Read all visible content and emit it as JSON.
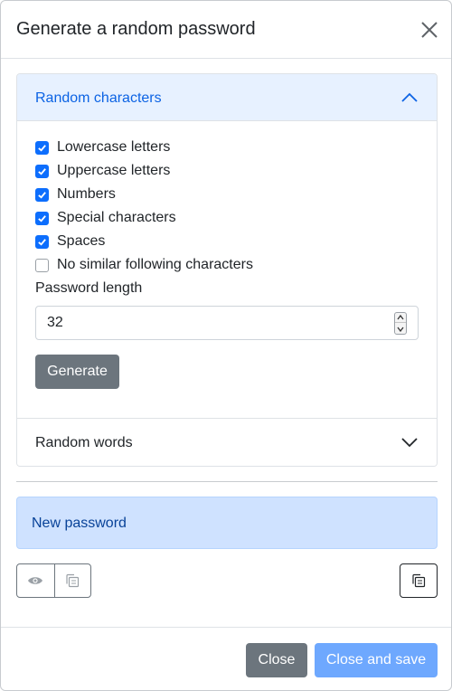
{
  "header": {
    "title": "Generate a random password",
    "close_icon": "close-icon"
  },
  "accordion": {
    "random_characters": {
      "label": "Random characters",
      "expanded": true,
      "options": [
        {
          "label": "Lowercase letters",
          "checked": true
        },
        {
          "label": "Uppercase letters",
          "checked": true
        },
        {
          "label": "Numbers",
          "checked": true
        },
        {
          "label": "Special characters",
          "checked": true
        },
        {
          "label": "Spaces",
          "checked": true
        },
        {
          "label": "No similar following characters",
          "checked": false
        }
      ],
      "length_label": "Password length",
      "length_value": "32",
      "generate_label": "Generate"
    },
    "random_words": {
      "label": "Random words",
      "expanded": false
    }
  },
  "result": {
    "password_text": "New password",
    "show_icon": "eye-icon",
    "copy_icon": "copy-icon"
  },
  "footer": {
    "close_label": "Close",
    "save_label": "Close and save"
  },
  "colors": {
    "primary": "#0d6efd",
    "secondary": "#6c757d",
    "accordion_active_bg": "#e7f1ff",
    "info_bg": "#cfe2ff",
    "save_disabled": "#6ea8fe"
  }
}
